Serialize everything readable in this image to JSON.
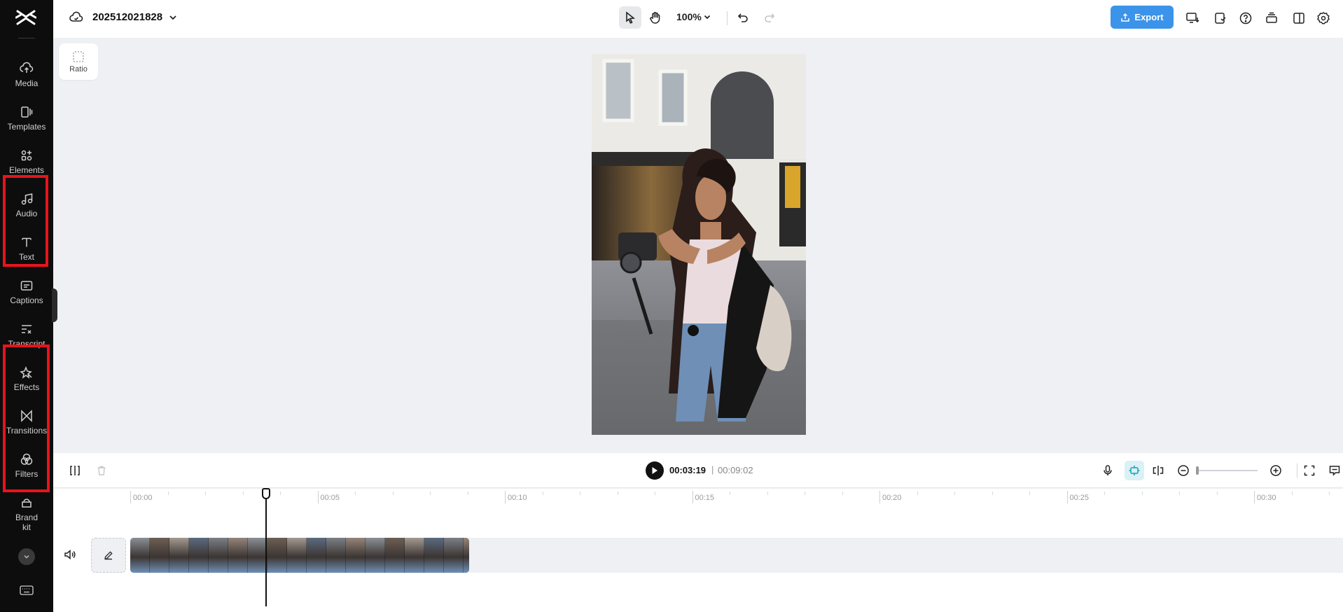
{
  "sidebar": {
    "items": [
      {
        "label": "Media",
        "icon": "cloud-upload-icon"
      },
      {
        "label": "Templates",
        "icon": "templates-icon"
      },
      {
        "label": "Elements",
        "icon": "elements-icon"
      },
      {
        "label": "Audio",
        "icon": "music-note-icon"
      },
      {
        "label": "Text",
        "icon": "text-icon"
      },
      {
        "label": "Captions",
        "icon": "captions-icon"
      },
      {
        "label": "Transcript",
        "icon": "transcript-icon"
      },
      {
        "label": "Effects",
        "icon": "effects-icon"
      },
      {
        "label": "Transitions",
        "icon": "transitions-icon"
      },
      {
        "label": "Filters",
        "icon": "filters-icon"
      },
      {
        "label": "Brand kit",
        "icon": "brand-kit-icon"
      }
    ],
    "highlight_color": "#e8141b"
  },
  "header": {
    "project_name": "202512021828",
    "zoom": "100%",
    "export_label": "Export",
    "accent_color": "#3b93ea"
  },
  "canvas": {
    "ratio_label": "Ratio"
  },
  "playback": {
    "current_time": "00:03:19",
    "separator": "|",
    "total_time": "00:09:02"
  },
  "timeline": {
    "ruler_labels": [
      "00:00",
      "00:05",
      "00:10",
      "00:15",
      "00:20",
      "00:25",
      "00:30"
    ]
  }
}
